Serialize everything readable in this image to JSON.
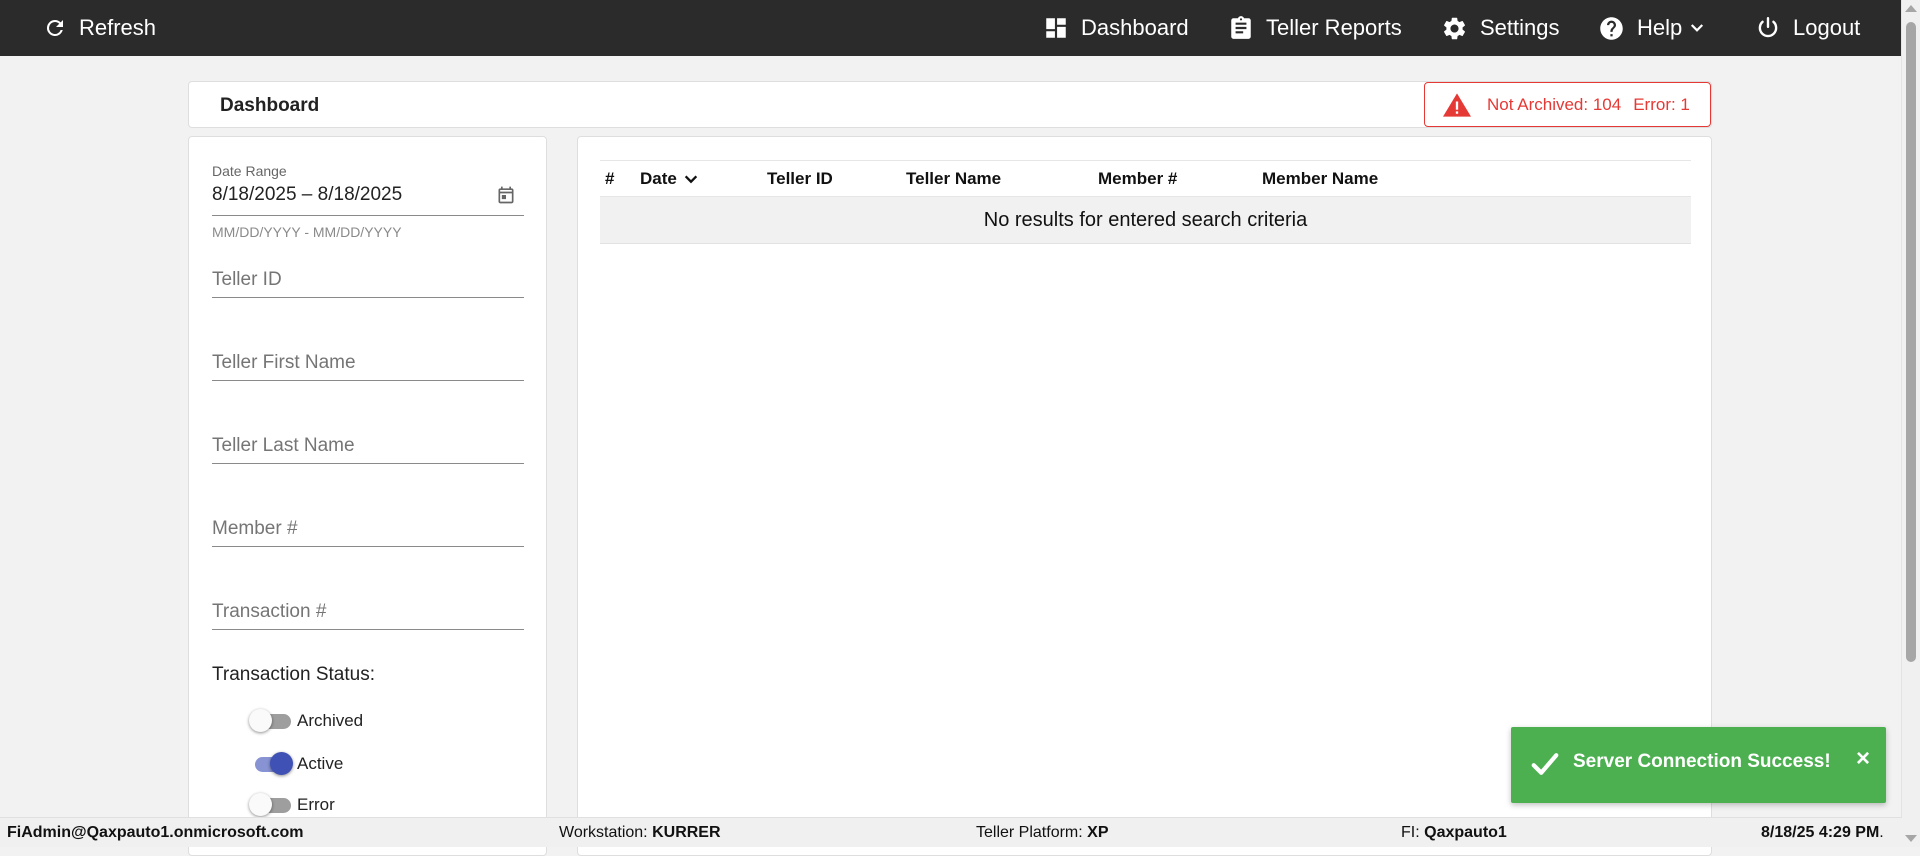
{
  "topbar": {
    "refresh_label": "Refresh",
    "dashboard_label": "Dashboard",
    "teller_reports_label": "Teller Reports",
    "settings_label": "Settings",
    "help_label": "Help",
    "logout_label": "Logout"
  },
  "header": {
    "title": "Dashboard",
    "alert": {
      "not_archived": "Not Archived: 104",
      "error": "Error: 1"
    }
  },
  "filters": {
    "date_range_label": "Date Range",
    "date_range_value": "8/18/2025 – 8/18/2025",
    "date_range_hint": "MM/DD/YYYY - MM/DD/YYYY",
    "teller_id_placeholder": "Teller ID",
    "teller_first_name_placeholder": "Teller First Name",
    "teller_last_name_placeholder": "Teller Last Name",
    "member_number_placeholder": "Member #",
    "transaction_number_placeholder": "Transaction #",
    "status_heading": "Transaction Status:",
    "statuses": [
      {
        "label": "Archived",
        "on": false
      },
      {
        "label": "Active",
        "on": true
      },
      {
        "label": "Error",
        "on": false
      }
    ]
  },
  "table": {
    "columns": [
      "#",
      "Date",
      "Teller ID",
      "Teller Name",
      "Member #",
      "Member Name"
    ],
    "empty_message": "No results for entered search criteria"
  },
  "toast": {
    "message": "Server Connection Success!",
    "close_glyph": "×"
  },
  "footer": {
    "user": "FiAdmin@Qaxpauto1.onmicrosoft.com",
    "workstation_label": "Workstation:",
    "workstation_value": "KURRER",
    "platform_label": "Teller Platform:",
    "platform_value": "XP",
    "fi_label": "FI:",
    "fi_value": "Qaxpauto1",
    "datetime": "8/18/25 4:29 PM",
    "datetime_suffix": "."
  },
  "colors": {
    "topbar": "#2b2b2b",
    "alert": "#e53935",
    "toggle_on": "#3f51b5",
    "toast": "#4caf50"
  }
}
